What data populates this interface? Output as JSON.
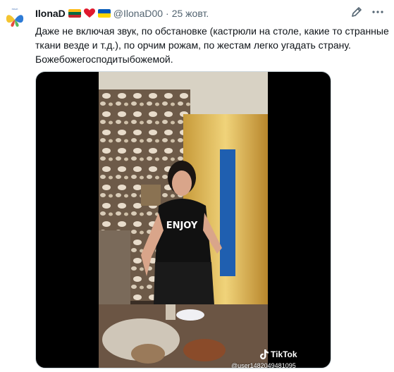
{
  "tweet": {
    "author_name": "IlonaD",
    "handle": "@IlonaD00",
    "separator": "·",
    "date": "25 жовт.",
    "text": "Даже не включая звук, по обстановке (кастрюли на столе, какие то странные ткани везде и т.д.), по орчим рожам, по жестам легко угадать страну. Божебожегосподитыбожемой.",
    "icons": [
      "avatar",
      "lithuania-flag",
      "red-heart",
      "ukraine-flag",
      "edit-icon",
      "more-icon"
    ]
  },
  "media": {
    "watermark_brand": "TikTok",
    "watermark_user": "@user1482049481095"
  },
  "colors": {
    "text": "#0f1419",
    "secondary": "#536471",
    "border": "#cfd9de"
  }
}
